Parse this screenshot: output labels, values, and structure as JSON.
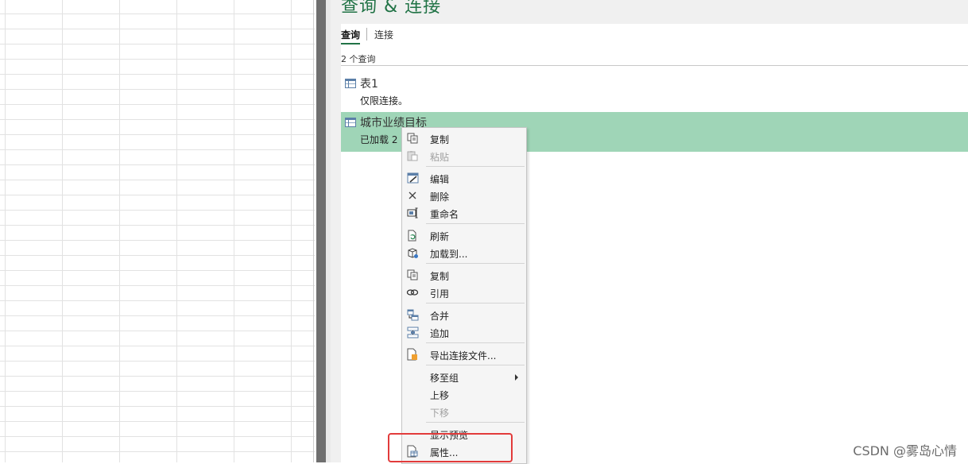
{
  "pane": {
    "title": "查询 & 连接",
    "tabs": [
      {
        "label": "查询",
        "active": true
      },
      {
        "label": "连接",
        "active": false
      }
    ],
    "count_text": "2 个查询",
    "queries": [
      {
        "name": "表1",
        "status": "仅限连接。",
        "selected": false
      },
      {
        "name": "城市业绩目标",
        "status": "已加载 2",
        "selected": true
      }
    ]
  },
  "context_menu": {
    "items": [
      {
        "label": "复制",
        "icon": "copy-icon",
        "disabled": false
      },
      {
        "label": "粘贴",
        "icon": "paste-icon",
        "disabled": true
      },
      {
        "label": "编辑",
        "icon": "edit-icon",
        "disabled": false
      },
      {
        "label": "删除",
        "icon": "delete-icon",
        "disabled": false
      },
      {
        "label": "重命名",
        "icon": "rename-icon",
        "disabled": false
      },
      {
        "label": "刷新",
        "icon": "refresh-icon",
        "disabled": false
      },
      {
        "label": "加载到...",
        "icon": "load-to-icon",
        "disabled": false
      },
      {
        "label": "复制",
        "icon": "duplicate-icon",
        "disabled": false
      },
      {
        "label": "引用",
        "icon": "reference-icon",
        "disabled": false
      },
      {
        "label": "合并",
        "icon": "merge-icon",
        "disabled": false
      },
      {
        "label": "追加",
        "icon": "append-icon",
        "disabled": false
      },
      {
        "label": "导出连接文件...",
        "icon": "export-connection-icon",
        "disabled": false
      },
      {
        "label": "移至组",
        "icon": "",
        "disabled": false,
        "submenu": true
      },
      {
        "label": "上移",
        "icon": "",
        "disabled": false
      },
      {
        "label": "下移",
        "icon": "",
        "disabled": true
      },
      {
        "label": "显示预览",
        "icon": "",
        "disabled": false
      },
      {
        "label": "属性...",
        "icon": "properties-icon",
        "disabled": false
      }
    ]
  },
  "annotation": {
    "color": "#e23b3b"
  },
  "watermark": "CSDN @雾岛心情",
  "colors": {
    "accent": "#217346",
    "selected_row": "#9fd5b7"
  }
}
